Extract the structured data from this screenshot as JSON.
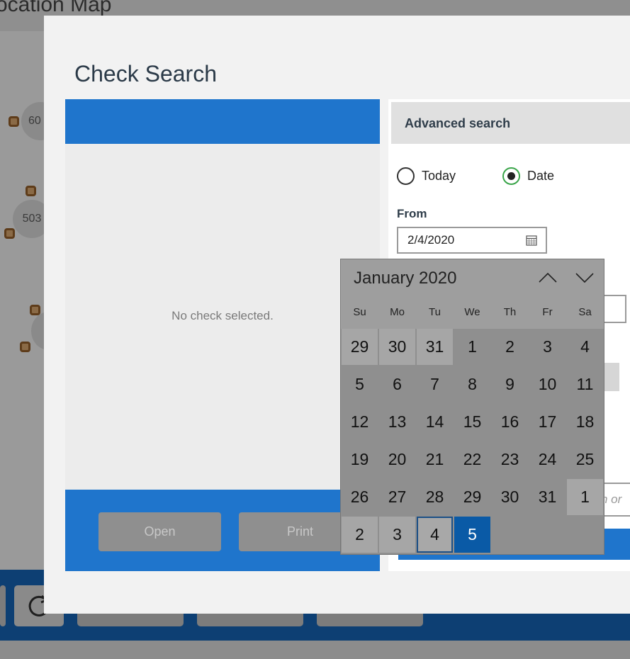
{
  "background": {
    "title": "ocation Map",
    "tables": [
      "60",
      "503"
    ]
  },
  "dialog": {
    "title": "Check Search",
    "left": {
      "empty_text": "No check selected.",
      "open_label": "Open",
      "print_label": "Print"
    },
    "advanced": {
      "title": "Advanced search",
      "radio_today": "Today",
      "radio_date": "Date",
      "selected_radio": "Date",
      "from_label": "From",
      "from_value": "2/4/2020",
      "partial_hint": "n or"
    }
  },
  "calendar": {
    "month_label": "January 2020",
    "weekdays": [
      "Su",
      "Mo",
      "Tu",
      "We",
      "Th",
      "Fr",
      "Sa"
    ],
    "weeks": [
      [
        "29",
        "30",
        "31",
        "1",
        "2",
        "3",
        "4"
      ],
      [
        "5",
        "6",
        "7",
        "8",
        "9",
        "10",
        "11"
      ],
      [
        "12",
        "13",
        "14",
        "15",
        "16",
        "17",
        "18"
      ],
      [
        "19",
        "20",
        "21",
        "22",
        "23",
        "24",
        "25"
      ],
      [
        "26",
        "27",
        "28",
        "29",
        "30",
        "31",
        "1"
      ],
      [
        "2",
        "3",
        "4",
        "5",
        "",
        "",
        ""
      ]
    ],
    "outlined_day": "4",
    "selected_day": "5"
  },
  "colors": {
    "accent_blue": "#1f75cc",
    "selected_blue": "#0a5aa6",
    "radio_green": "#3aa54a"
  }
}
